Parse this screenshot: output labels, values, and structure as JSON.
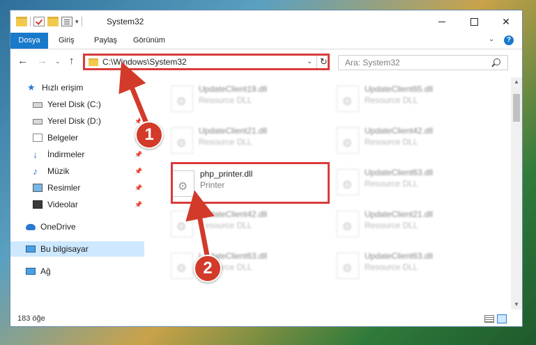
{
  "window": {
    "title": "System32"
  },
  "ribbon": {
    "tabs": [
      "Dosya",
      "Giriş",
      "Paylaş",
      "Görünüm"
    ],
    "help_label": "?"
  },
  "nav": {
    "address": "C:\\Windows\\System32",
    "search_placeholder": "Ara: System32"
  },
  "sidebar": {
    "items": [
      {
        "label": "Hızlı erişim",
        "icon": "star-icon"
      },
      {
        "label": "Yerel Disk (C:)",
        "icon": "drive-icon",
        "pinned": true
      },
      {
        "label": "Yerel Disk (D:)",
        "icon": "drive-icon",
        "pinned": true
      },
      {
        "label": "Belgeler",
        "icon": "documents-icon",
        "pinned": true
      },
      {
        "label": "İndirmeler",
        "icon": "downloads-icon",
        "pinned": true
      },
      {
        "label": "Müzik",
        "icon": "music-icon",
        "pinned": true
      },
      {
        "label": "Resimler",
        "icon": "pictures-icon",
        "pinned": true
      },
      {
        "label": "Videolar",
        "icon": "videos-icon",
        "pinned": true
      },
      {
        "label": "OneDrive",
        "icon": "onedrive-icon"
      },
      {
        "label": "Bu bilgisayar",
        "icon": "this-pc-icon",
        "selected": true
      },
      {
        "label": "Ağ",
        "icon": "network-icon"
      }
    ]
  },
  "files": [
    {
      "name": "UpdateClient19.dll",
      "type": "Resource DLL"
    },
    {
      "name": "UpdateClient65.dll",
      "type": "Resource DLL"
    },
    {
      "name": "UpdateClient21.dll",
      "type": "Resource DLL"
    },
    {
      "name": "UpdateClient42.dll",
      "type": "Resource DLL"
    },
    {
      "name": "php_printer.dll",
      "type": "Printer"
    },
    {
      "name": "UpdateClient63.dll",
      "type": "Resource DLL"
    },
    {
      "name": "UpdateClient42.dll",
      "type": "Resource DLL"
    },
    {
      "name": "UpdateClient21.dll",
      "type": "Resource DLL"
    },
    {
      "name": "UpdateClient63.dll",
      "type": "Resource DLL"
    },
    {
      "name": "UpdateClient63.dll",
      "type": "Resource DLL"
    }
  ],
  "status": {
    "item_count": "183 öğe"
  },
  "annotations": {
    "step1": "1",
    "step2": "2"
  },
  "colors": {
    "accent": "#1979ca",
    "highlight": "#d93b3b",
    "badge": "#d23a2a",
    "selected": "#cde8ff"
  }
}
